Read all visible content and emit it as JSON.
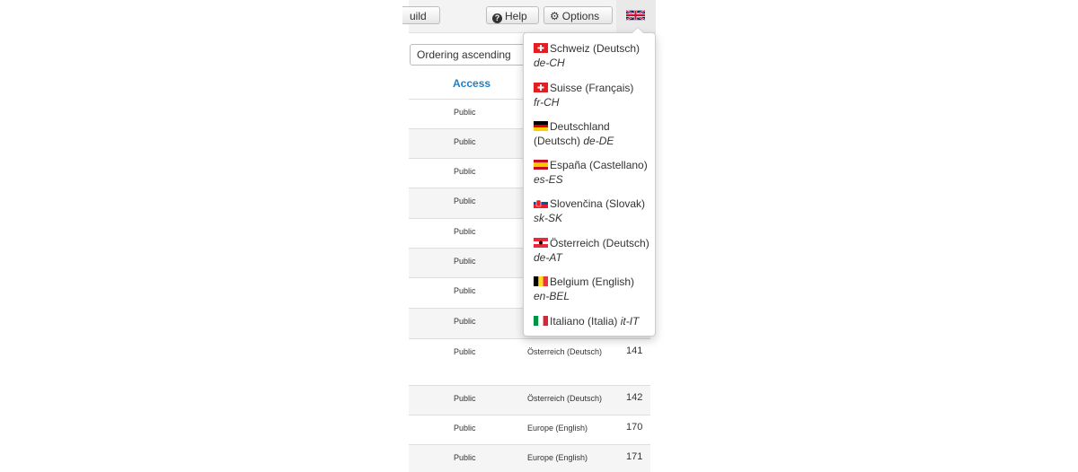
{
  "toolbar": {
    "rebuild_label": "uild",
    "help_label": "Help",
    "options_label": "Options",
    "language_icon": "uk-flag-icon"
  },
  "filter": {
    "ordering_value": "Ordering ascending"
  },
  "table": {
    "access_header": "Access",
    "rows": [
      {
        "access": "Public",
        "language": "",
        "id": ""
      },
      {
        "access": "Public",
        "language": "",
        "id": ""
      },
      {
        "access": "Public",
        "language": "",
        "id": ""
      },
      {
        "access": "Public",
        "language": "",
        "id": ""
      },
      {
        "access": "Public",
        "language": "",
        "id": ""
      },
      {
        "access": "Public",
        "language": "",
        "id": ""
      },
      {
        "access": "Public",
        "language": "",
        "id": ""
      },
      {
        "access": "Public",
        "language": "",
        "id": ""
      },
      {
        "access": "Public",
        "language": "Österreich (Deutsch)",
        "id": "141"
      },
      {
        "access": "Public",
        "language": "Österreich (Deutsch)",
        "id": "142"
      },
      {
        "access": "Public",
        "language": "Europe (English)",
        "id": "170"
      },
      {
        "access": "Public",
        "language": "Europe (English)",
        "id": "171"
      }
    ]
  },
  "language_menu": {
    "items": [
      {
        "name": "Schweiz (Deutsch)",
        "code": "de-CH",
        "flag": "switzerland-flag-icon"
      },
      {
        "name": "Suisse (Français)",
        "code": "fr-CH",
        "flag": "switzerland-flag-icon"
      },
      {
        "name": "Deutschland (Deutsch)",
        "code": "de-DE",
        "flag": "germany-flag-icon"
      },
      {
        "name": "España (Castellano)",
        "code": "es-ES",
        "flag": "spain-flag-icon"
      },
      {
        "name": "Slovenčina (Slovak)",
        "code": "sk-SK",
        "flag": "slovakia-flag-icon"
      },
      {
        "name": "Österreich (Deutsch)",
        "code": "de-AT",
        "flag": "austria-flag-icon"
      },
      {
        "name": "Belgium (English)",
        "code": "en-BEL",
        "flag": "belgium-flag-icon"
      },
      {
        "name": "Italiano (Italia)",
        "code": "it-IT",
        "flag": "italy-flag-icon"
      }
    ]
  }
}
